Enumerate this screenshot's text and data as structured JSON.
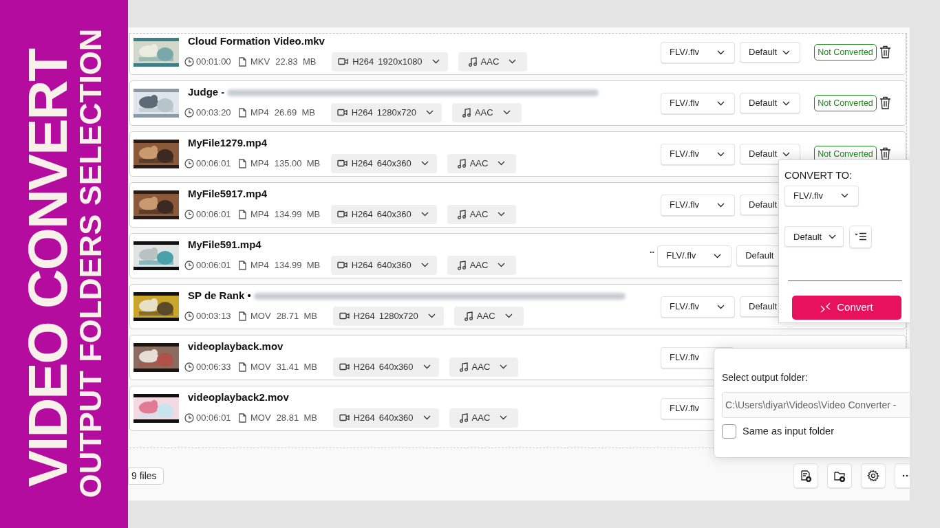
{
  "banner": {
    "title": "VIDEO CONVERT",
    "subtitle": "OUTPUT FOLDERS SELECTION"
  },
  "files": [
    {
      "name": "Cloud Formation Video.mkv",
      "duration": "00:01:00",
      "container": "MKV",
      "size": "22.83  MB",
      "codec": "H264",
      "resolution": "1920x1080",
      "audio": "AAC",
      "format": "FLV/.flv",
      "quality": "Default",
      "status": "Not Converted"
    },
    {
      "name": "Judge -",
      "redacted": true,
      "duration": "00:03:20",
      "container": "MP4",
      "size": "26.69  MB",
      "codec": "H264",
      "resolution": "1280x720",
      "audio": "AAC",
      "format": "FLV/.flv",
      "quality": "Default",
      "status": "Not Converted"
    },
    {
      "name": "MyFile1279.mp4",
      "duration": "00:06:01",
      "container": "MP4",
      "size": "135.00  MB",
      "codec": "H264",
      "resolution": "640x360",
      "audio": "AAC",
      "format": "FLV/.flv",
      "quality": "Default",
      "status": "Not Converted"
    },
    {
      "name": "MyFile5917.mp4",
      "duration": "00:06:01",
      "container": "MP4",
      "size": "134.99  MB",
      "codec": "H264",
      "resolution": "640x360",
      "audio": "AAC",
      "format": "FLV/.flv",
      "quality": "Default"
    },
    {
      "name": "MyFile591.mp4",
      "trail": "..",
      "duration": "00:06:01",
      "container": "MP4",
      "size": "134.99  MB",
      "codec": "H264",
      "resolution": "640x360",
      "audio": "AAC",
      "format": "FLV/.flv",
      "quality": "Default"
    },
    {
      "name": "SP de Rank •",
      "redacted": true,
      "duration": "00:03:13",
      "container": "MOV",
      "size": "28.71  MB",
      "codec": "H264",
      "resolution": "1280x720",
      "audio": "AAC",
      "format": "FLV/.flv",
      "quality": "Default"
    },
    {
      "name": "videoplayback.mov",
      "duration": "00:06:33",
      "container": "MOV",
      "size": "31.41  MB",
      "codec": "H264",
      "resolution": "640x360",
      "audio": "AAC",
      "format": "FLV/.flv"
    },
    {
      "name": "videoplayback2.mov",
      "duration": "00:06:01",
      "container": "MOV",
      "size": "28.81  MB",
      "codec": "H264",
      "resolution": "640x360",
      "audio": "AAC",
      "format": "FLV/.flv"
    }
  ],
  "file_count": "9 files",
  "convert_popup": {
    "heading": "CONVERT TO:",
    "format": "FLV/.flv",
    "quality": "Default",
    "button": "Convert"
  },
  "output_popup": {
    "label": "Select output folder:",
    "path": "C:\\Users\\diyar\\Videos\\Video Converter -",
    "same_as_input": {
      "label": "Same as input folder",
      "checked": false
    }
  }
}
